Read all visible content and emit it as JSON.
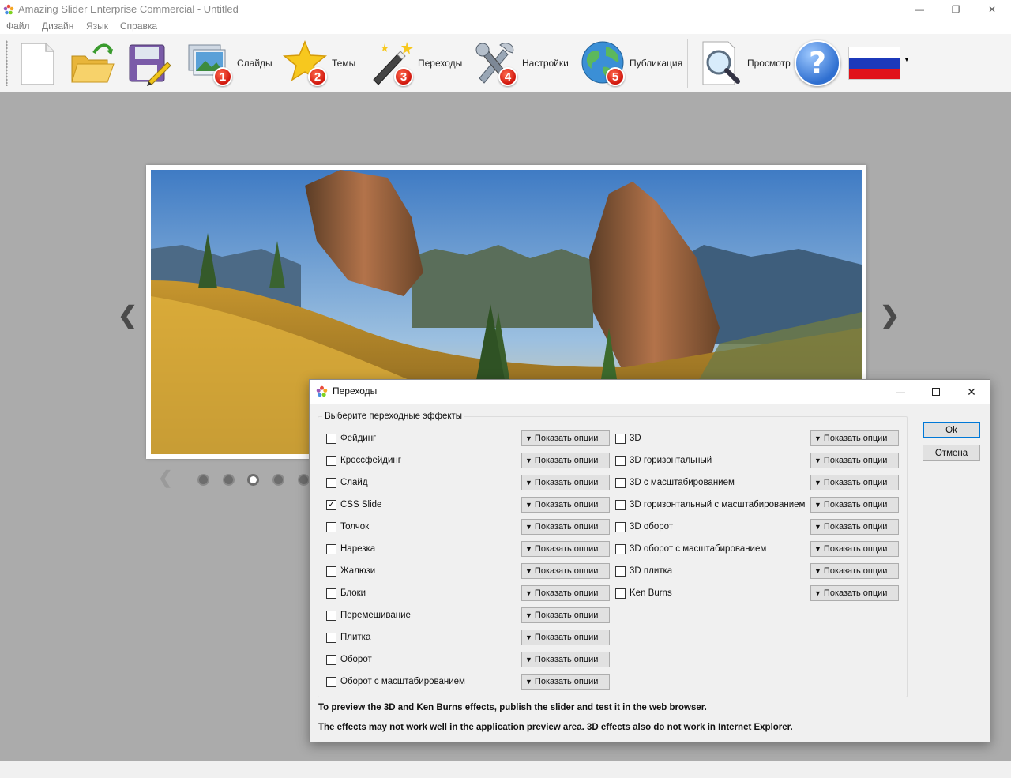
{
  "window": {
    "title": "Amazing Slider Enterprise Commercial - Untitled",
    "minimize_glyph": "—",
    "restore_glyph": "❐",
    "close_glyph": "✕"
  },
  "menu": {
    "items": [
      "Файл",
      "Дизайн",
      "Язык",
      "Справка"
    ]
  },
  "toolbar": {
    "new_icon": "new-document-icon",
    "open_icon": "open-folder-icon",
    "save_icon": "save-disk-icon",
    "slides": {
      "label": "Слайды",
      "badge": "1"
    },
    "themes": {
      "label": "Темы",
      "badge": "2"
    },
    "transitions": {
      "label": "Переходы",
      "badge": "3"
    },
    "settings": {
      "label": "Настройки",
      "badge": "4"
    },
    "publish": {
      "label": "Публикация",
      "badge": "5"
    },
    "preview": {
      "label": "Просмотр"
    },
    "help_glyph": "?",
    "language_flag": "russia-flag-icon"
  },
  "preview": {
    "prev_arrow": "❮",
    "next_arrow": "❯",
    "bullet_count": 5,
    "active_bullet": 3
  },
  "dialog": {
    "title": "Переходы",
    "group_caption": "Выберите переходные эффекты",
    "show_options_label": "Показать опции",
    "ok_label": "Ok",
    "cancel_label": "Отмена",
    "left_effects": [
      {
        "label": "Фейдинг",
        "checked": false
      },
      {
        "label": "Кроссфейдинг",
        "checked": false
      },
      {
        "label": "Слайд",
        "checked": false
      },
      {
        "label": "CSS Slide",
        "checked": true
      },
      {
        "label": "Толчок",
        "checked": false
      },
      {
        "label": "Нарезка",
        "checked": false
      },
      {
        "label": "Жалюзи",
        "checked": false
      },
      {
        "label": "Блоки",
        "checked": false
      },
      {
        "label": "Перемешивание",
        "checked": false
      },
      {
        "label": "Плитка",
        "checked": false
      },
      {
        "label": "Оборот",
        "checked": false
      },
      {
        "label": "Оборот с масштабированием",
        "checked": false
      }
    ],
    "right_effects": [
      {
        "label": "3D",
        "checked": false
      },
      {
        "label": "3D горизонтальный",
        "checked": false
      },
      {
        "label": "3D с масштабированием",
        "checked": false
      },
      {
        "label": "3D горизонтальный с масштабированием",
        "checked": false
      },
      {
        "label": "3D оборот",
        "checked": false
      },
      {
        "label": "3D оборот с масштабированием",
        "checked": false
      },
      {
        "label": "3D плитка",
        "checked": false
      },
      {
        "label": "Ken Burns",
        "checked": false
      }
    ],
    "note1": "To preview the 3D and Ken Burns effects, publish the slider and test it in the web browser.",
    "note2": "The effects may not work well in the application preview area. 3D effects also do not work in Internet Explorer."
  },
  "colors": {
    "workspace": "#ababab",
    "accent": "#0078d7",
    "badge": "#d0160c"
  }
}
